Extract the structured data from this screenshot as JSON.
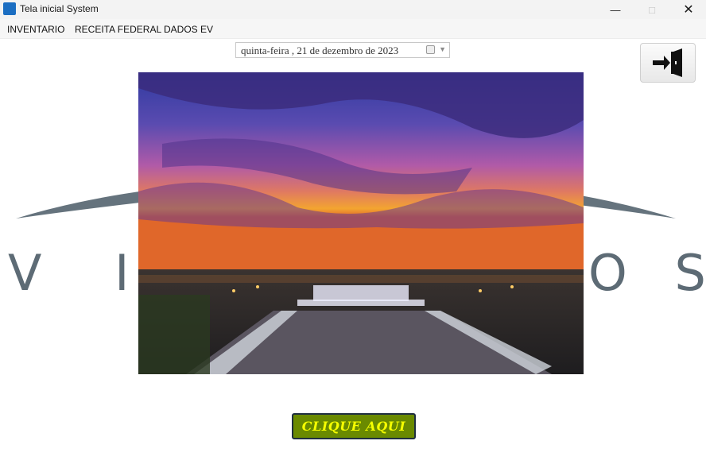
{
  "window": {
    "title": "Tela inicial System",
    "icon": "app-icon"
  },
  "menu": {
    "items": [
      {
        "label": "INVENTARIO"
      },
      {
        "label": "RECEITA FEDERAL"
      },
      {
        "label": "DADOS EV"
      }
    ]
  },
  "date_picker": {
    "value": "quinta-feira  , 21 de dezembro de 2023",
    "icon": "calendar-icon"
  },
  "exit_button": {
    "icon": "exit-door-icon"
  },
  "background_logo": {
    "text_left": "V I",
    "text_right": "O S"
  },
  "cta_button": {
    "label": "CLIQUE AQUI",
    "bg_color": "#6a8a00",
    "text_color": "#f6ff00"
  },
  "colors": {
    "accent": "#1b6ec2"
  }
}
